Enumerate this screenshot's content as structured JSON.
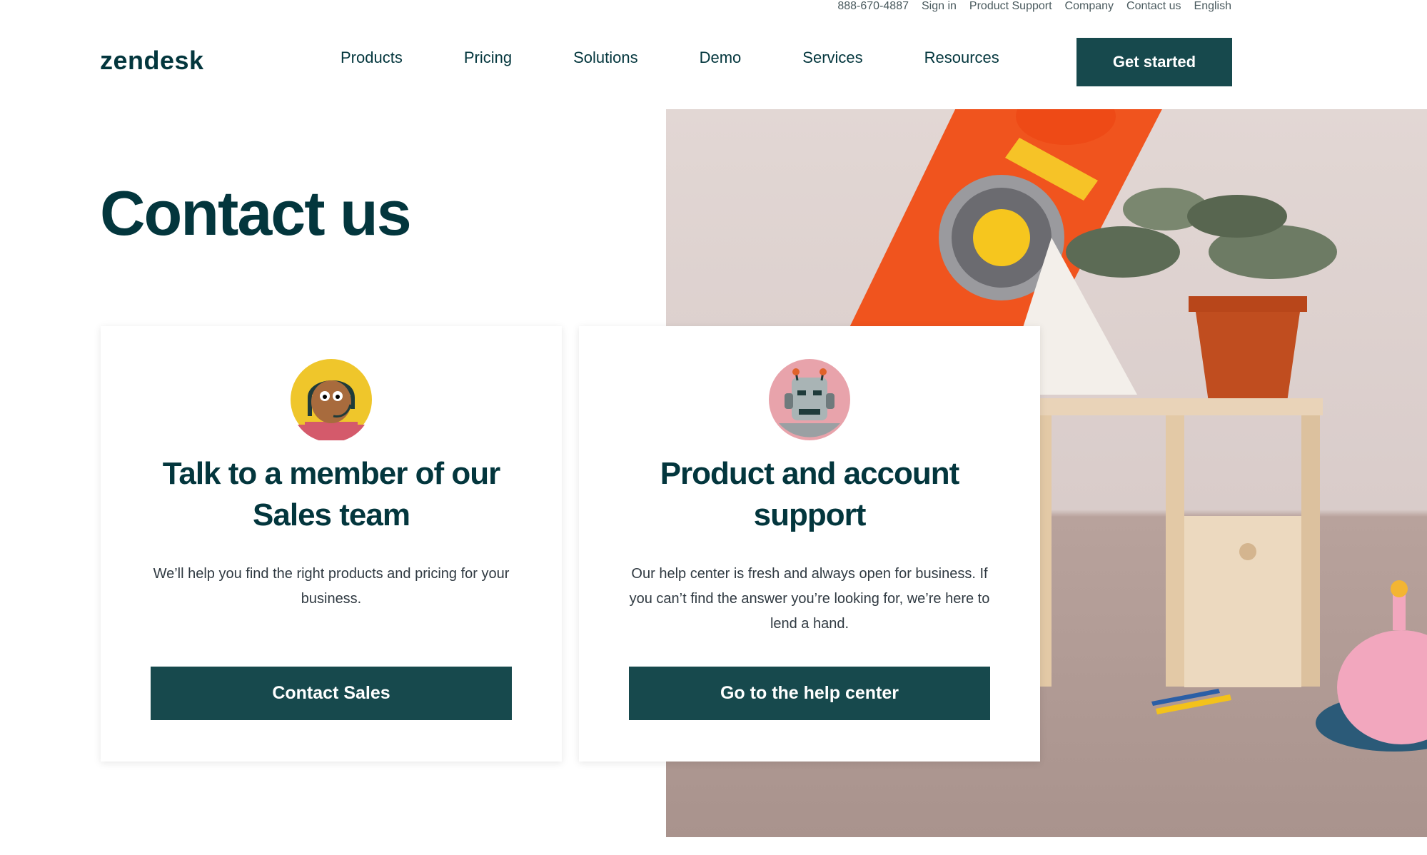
{
  "utility_bar": {
    "phone": "888-670-4887",
    "sign_in": "Sign in",
    "product_support": "Product Support",
    "company": "Company",
    "contact_us": "Contact us",
    "language": "English"
  },
  "header": {
    "logo": "zendesk",
    "nav": [
      "Products",
      "Pricing",
      "Solutions",
      "Demo",
      "Services",
      "Resources"
    ],
    "cta": "Get started"
  },
  "hero": {
    "title": "Contact us"
  },
  "cards": [
    {
      "avatar_icon": "sales-agent-avatar-icon",
      "title": "Talk to a member of our Sales team",
      "body": "We’ll help you find the right products and pricing for your business.",
      "button": "Contact Sales"
    },
    {
      "avatar_icon": "robot-avatar-icon",
      "title": "Product and account support",
      "body": "Our help center is fresh and always open for business. If you can’t find the answer you’re looking for, we’re here to lend a hand.",
      "button": "Go to the help center"
    }
  ],
  "colors": {
    "brand": "#03363d",
    "button": "#17494d"
  }
}
